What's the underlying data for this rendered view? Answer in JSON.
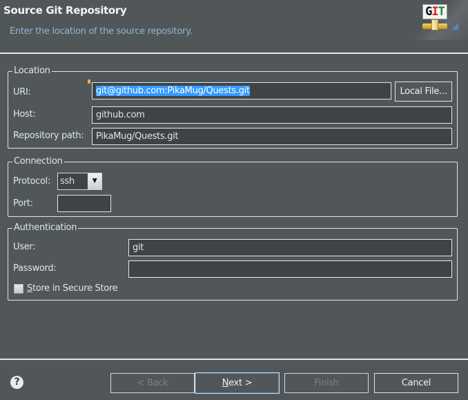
{
  "header": {
    "title": "Source Git Repository",
    "subtitle": "Enter the location of the source repository.",
    "logo_text": "GIT"
  },
  "location": {
    "legend": "Location",
    "uri_label": "URI:",
    "uri_value": "git@github.com:PikaMug/Quests.git",
    "local_file_label": "Local File...",
    "host_label": "Host:",
    "host_value": "github.com",
    "repo_path_label": "Repository path:",
    "repo_path_value": "PikaMug/Quests.git"
  },
  "connection": {
    "legend": "Connection",
    "protocol_label": "Protocol:",
    "protocol_value": "ssh",
    "port_label": "Port:",
    "port_value": ""
  },
  "authentication": {
    "legend": "Authentication",
    "user_label": "User:",
    "user_value": "git",
    "password_label": "Password:",
    "password_value": "",
    "store_label_first": "S",
    "store_label_rest": "tore in Secure Store",
    "store_checked": false
  },
  "footer": {
    "back_label": "< Back",
    "next_first": "N",
    "next_rest": "ext >",
    "finish_label": "Finish",
    "cancel_label": "Cancel"
  },
  "colors": {
    "background": "#515658",
    "input": "#3f4346",
    "selection": "#3399ff",
    "subtitle": "#8fb6d2"
  }
}
